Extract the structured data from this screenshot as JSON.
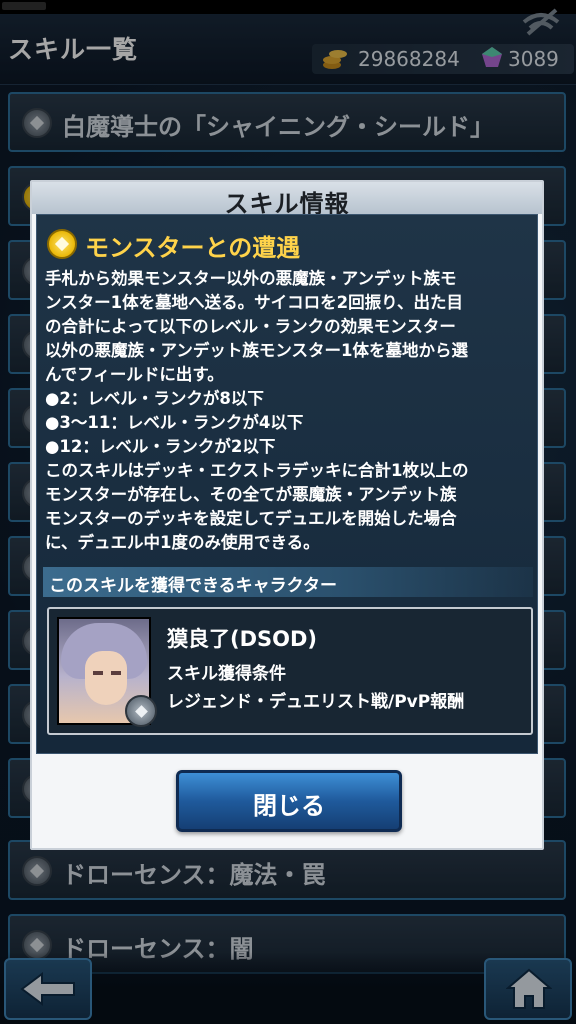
{
  "header": {
    "title": "スキル一覧",
    "gold": "29868284",
    "gems": "3089"
  },
  "skill_list": [
    {
      "label": "白魔導士の「シャイニング・シールド」"
    },
    {
      "label": ""
    },
    {
      "label": ""
    },
    {
      "label": ""
    },
    {
      "label": ""
    },
    {
      "label": ""
    },
    {
      "label": ""
    },
    {
      "label": ""
    },
    {
      "label": ""
    },
    {
      "label": ""
    },
    {
      "label": ""
    },
    {
      "label": "ドローセンス：魔法・罠"
    },
    {
      "label": "ドローセンス：闇"
    }
  ],
  "modal": {
    "title": "スキル情報",
    "skill_name": "モンスターとの遭遇",
    "description": [
      "手札から効果モンスター以外の悪魔族・アンデット族モ",
      "ンスター1体を墓地へ送る。サイコロを2回振り、出た目",
      "の合計によって以下のレベル・ランクの効果モンスター",
      "以外の悪魔族・アンデット族モンスター1体を墓地から選",
      "んでフィールドに出す。",
      "●2：レベル・ランクが8以下",
      "●3〜11：レベル・ランクが4以下",
      "●12：レベル・ランクが2以下",
      "このスキルはデッキ・エクストラデッキに合計1枚以上の",
      "モンスターが存在し、その全てが悪魔族・アンデット族",
      "モンスターのデッキを設定してデュエルを開始した場合",
      "に、デュエル中1度のみ使用できる。"
    ],
    "section_label": "このスキルを獲得できるキャラクター",
    "character": {
      "name": "獏良了(DSOD)",
      "condition_label": "スキル獲得条件",
      "condition_value": "レジェンド・デュエリスト戦/PvP報酬"
    },
    "close_label": "閉じる"
  },
  "colors": {
    "skill_name": "#ffd34a",
    "button_blue": "#1f5a9c",
    "row_border": "#2d6f9a"
  }
}
